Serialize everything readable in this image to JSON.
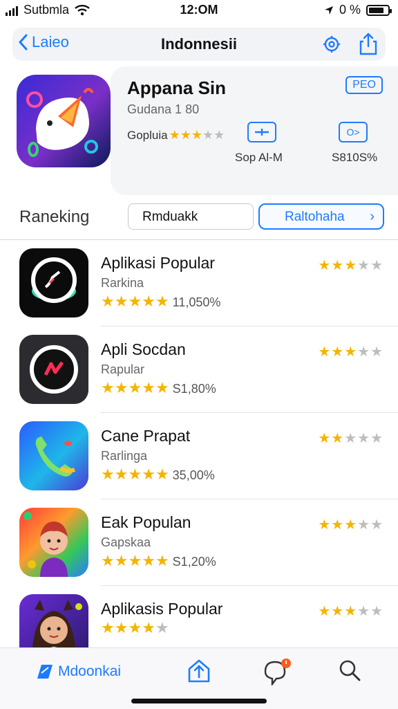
{
  "status": {
    "carrier": "Sutbmla",
    "time": "12:OM",
    "battery_text": "0 %",
    "battery_level": 0.8
  },
  "nav": {
    "back_label": "Laieo",
    "title": "Indonnesii"
  },
  "hero": {
    "name": "Appana Sin",
    "developer": "Gudana 1 80",
    "rating_text": "Gopluia",
    "rating_stars": 3,
    "badge": "PEO",
    "action_a_label": "Sop Al-M",
    "action_b_glyph": "O>",
    "action_b_label": "S810S%"
  },
  "segment": {
    "label": "Raneking",
    "option1": "Rmduakk",
    "option2": "Raltohaha"
  },
  "apps": [
    {
      "title": "Aplikasi Popular",
      "subtitle": "Rarkina",
      "stats": "11,050%",
      "stars": 5,
      "mini_stars": 2.5
    },
    {
      "title": "Apli Socdan",
      "subtitle": "Rapular",
      "stats": "S1,80%",
      "stars": 5,
      "mini_stars": 2.5
    },
    {
      "title": "Cane Prapat",
      "subtitle": "Rarlinga",
      "stats": "35,00%",
      "stars": 5,
      "mini_stars": 2
    },
    {
      "title": "Eak Populan",
      "subtitle": "Gapskaa",
      "stats": "S1,20%",
      "stars": 5,
      "mini_stars": 3
    },
    {
      "title": "Aplikasis Popular",
      "subtitle": "",
      "stats": "",
      "stars": 3.5,
      "mini_stars": 2.5
    }
  ],
  "tabs": {
    "tab1_label": "Mdoonkai"
  },
  "colors": {
    "accent": "#1e7bff",
    "star": "#f4b400",
    "star_off": "#bdbdbd"
  }
}
